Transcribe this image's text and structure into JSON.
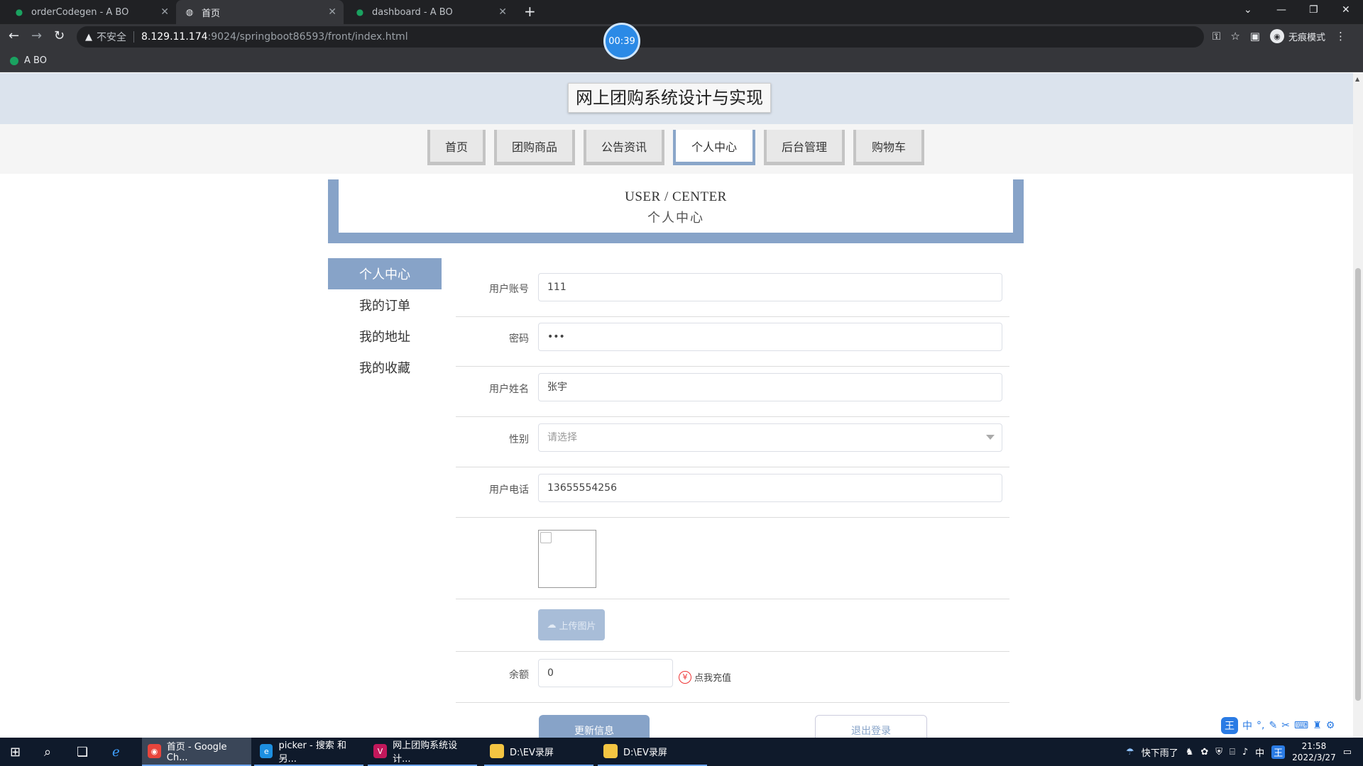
{
  "browser": {
    "tabs": [
      {
        "title": "orderCodegen - A BO"
      },
      {
        "title": "首页"
      },
      {
        "title": "dashboard - A BO"
      }
    ],
    "address": {
      "insecure_label": "不安全",
      "host": "8.129.11.174",
      "path": ":9024/springboot86593/front/index.html"
    },
    "incognito_label": "无痕模式",
    "bookmark": "A BO",
    "timer": "00:39"
  },
  "site": {
    "title": "网上团购系统设计与实现",
    "nav": [
      "首页",
      "团购商品",
      "公告资讯",
      "个人中心",
      "后台管理",
      "购物车"
    ],
    "banner": {
      "en": "USER / CENTER",
      "cn": "个人中心"
    },
    "side_menu": [
      "个人中心",
      "我的订单",
      "我的地址",
      "我的收藏"
    ]
  },
  "form": {
    "account": {
      "label": "用户账号",
      "value": "111"
    },
    "password": {
      "label": "密码",
      "value": "•••"
    },
    "name": {
      "label": "用户姓名",
      "value": "张宇"
    },
    "gender": {
      "label": "性别",
      "placeholder": "请选择"
    },
    "phone": {
      "label": "用户电话",
      "value": "13655554256"
    },
    "upload_label": "上传图片",
    "balance": {
      "label": "余额",
      "value": "0"
    },
    "recharge_label": "点我充值",
    "update_label": "更新信息",
    "logout_label": "退出登录"
  },
  "taskbar": {
    "items": [
      "首页 - Google Ch...",
      "picker - 搜索 和另...",
      "网上团购系统设计...",
      "D:\\EV录屏",
      "D:\\EV录屏"
    ],
    "weather": "快下雨了",
    "ime": "中",
    "time": "21:58",
    "date": "2022/3/27"
  },
  "colors": {
    "accent": "#87a3c8",
    "header_bg": "#dbe3ed",
    "chrome_dark": "#35363a"
  }
}
